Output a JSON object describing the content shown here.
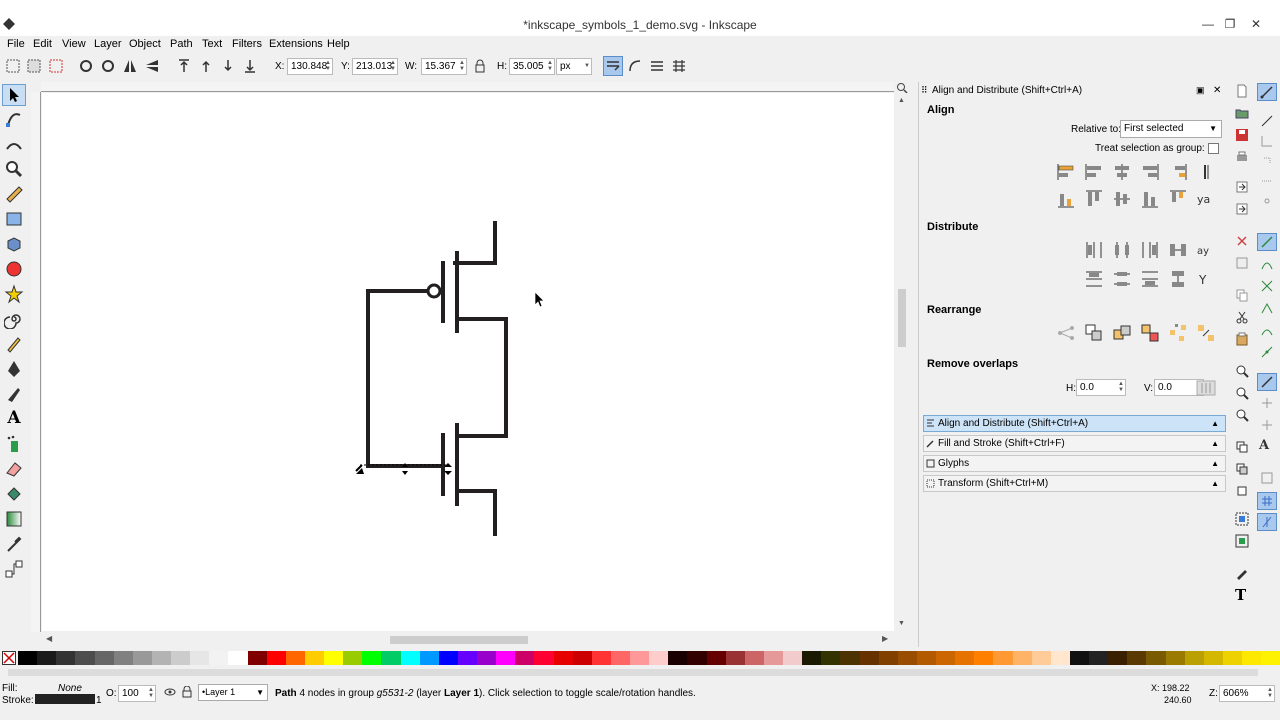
{
  "window": {
    "title": "*inkscape_symbols_1_demo.svg - Inkscape",
    "min": "—",
    "max": "❐",
    "close": "✕"
  },
  "menu": [
    "File",
    "Edit",
    "View",
    "Layer",
    "Object",
    "Path",
    "Text",
    "Filters",
    "Extensions",
    "Help"
  ],
  "controls": {
    "x_label": "X:",
    "x_value": "130.848",
    "y_label": "Y:",
    "y_value": "213.013",
    "w_label": "W:",
    "w_value": "15.367",
    "h_label": "H:",
    "h_value": "35.005",
    "unit": "px"
  },
  "dock": {
    "header": "Align and Distribute (Shift+Ctrl+A)",
    "align_title": "Align",
    "relative_label": "Relative to:",
    "relative_value": "First selected",
    "treat_group": "Treat selection as group:",
    "distribute_title": "Distribute",
    "rearrange_title": "Rearrange",
    "remove_overlaps_title": "Remove overlaps",
    "h_label": "H:",
    "h_value": "0.0",
    "v_label": "V:",
    "v_value": "0.0",
    "panels": [
      {
        "label": "Align and Distribute (Shift+Ctrl+A)"
      },
      {
        "label": "Fill and Stroke (Shift+Ctrl+F)"
      },
      {
        "label": "Glyphs"
      },
      {
        "label": "Transform (Shift+Ctrl+M)"
      }
    ]
  },
  "status": {
    "fill_label": "Fill:",
    "fill_value": "None",
    "stroke_label": "Stroke:",
    "stroke_width": "1",
    "opacity_label": "O:",
    "opacity_value": "100",
    "layer": "•Layer 1",
    "message_bold": "Path",
    "message_1": " 4 nodes in group ",
    "message_italic": "g5531-2",
    "message_2": " (layer ",
    "message_bold2": "Layer 1",
    "message_3": "). Click selection to toggle scale/rotation handles.",
    "cursor_x": "X: 198.22",
    "cursor_y": "240.60",
    "zoom_label": "Z:",
    "zoom": "606%"
  },
  "palette_colors": [
    "#000000",
    "#1a1a1a",
    "#333333",
    "#4d4d4d",
    "#666666",
    "#808080",
    "#999999",
    "#b3b3b3",
    "#cccccc",
    "#e6e6e6",
    "#f2f2f2",
    "#ffffff",
    "#800000",
    "#ff0000",
    "#ff6600",
    "#ffcc00",
    "#ffff00",
    "#99cc00",
    "#00ff00",
    "#00cc66",
    "#00ffff",
    "#0099ff",
    "#0000ff",
    "#6600ff",
    "#9900cc",
    "#ff00ff",
    "#cc0066",
    "#ff0033",
    "#e60000",
    "#cc0000",
    "#ff3333",
    "#ff6666",
    "#ff9999",
    "#ffcccc",
    "#1a0000",
    "#330000",
    "#660000",
    "#993333",
    "#cc6666",
    "#e69999",
    "#f2cccc",
    "#1a1a00",
    "#333300",
    "#4d3300",
    "#663300",
    "#804000",
    "#994d00",
    "#b35900",
    "#cc6600",
    "#e67300",
    "#ff8000",
    "#ff9933",
    "#ffb366",
    "#ffcc99",
    "#ffe6cc",
    "#111111",
    "#222222",
    "#3a1f00",
    "#5a3a00",
    "#7a5a00",
    "#9a7a00",
    "#baa000",
    "#d4b800",
    "#eed200",
    "#ffe800",
    "#fff200"
  ]
}
